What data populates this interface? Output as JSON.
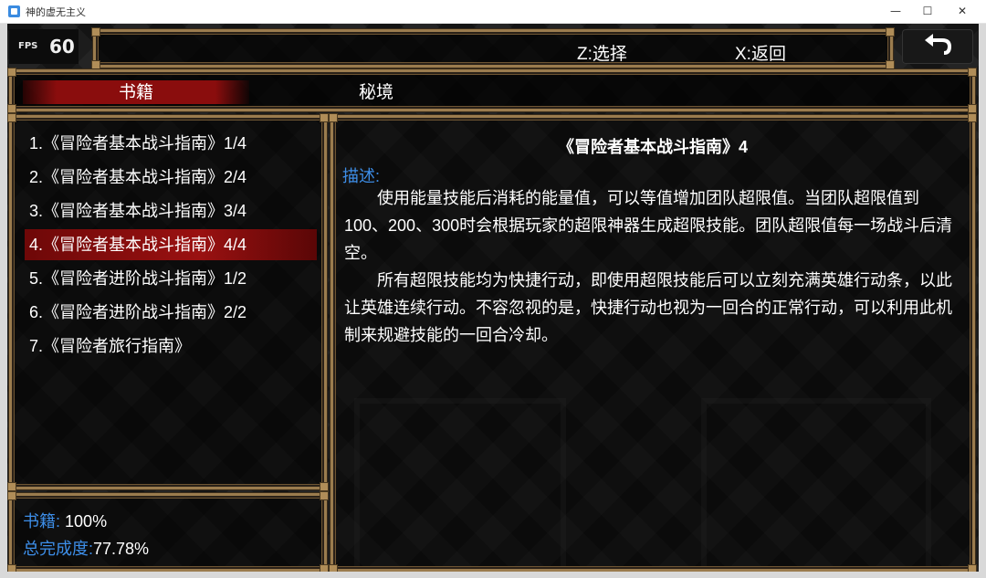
{
  "window": {
    "title": "神的虚无主义",
    "minimize": "—",
    "maximize": "☐",
    "close": "✕"
  },
  "fps": {
    "label": "FPS",
    "value": "60"
  },
  "hints": {
    "select": "Z:选择",
    "back": "X:返回"
  },
  "tabs": [
    {
      "label": "书籍",
      "active": true
    },
    {
      "label": "秘境",
      "active": false
    }
  ],
  "book_list": [
    {
      "label": "1.《冒险者基本战斗指南》1/4",
      "selected": false
    },
    {
      "label": "2.《冒险者基本战斗指南》2/4",
      "selected": false
    },
    {
      "label": "3.《冒险者基本战斗指南》3/4",
      "selected": false
    },
    {
      "label": "4.《冒险者基本战斗指南》4/4",
      "selected": true
    },
    {
      "label": "5.《冒险者进阶战斗指南》1/2",
      "selected": false
    },
    {
      "label": "6.《冒险者进阶战斗指南》2/2",
      "selected": false
    },
    {
      "label": "7.《冒险者旅行指南》",
      "selected": false
    }
  ],
  "stats": {
    "books_label": "书籍:",
    "books_value": "100%",
    "total_label": "总完成度:",
    "total_value": "77.78%"
  },
  "detail": {
    "title": "《冒险者基本战斗指南》4",
    "desc_label": "描述:",
    "paragraph1": "使用能量技能后消耗的能量值，可以等值增加团队超限值。当团队超限值到100、200、300时会根据玩家的超限神器生成超限技能。团队超限值每一场战斗后清空。",
    "paragraph2": "所有超限技能均为快捷行动，即使用超限技能后可以立刻充满英雄行动条，以此让英雄连续行动。不容忽视的是，快捷行动也视为一回合的正常行动，可以利用此机制来规避技能的一回合冷却。"
  },
  "colors": {
    "accent_blue": "#3d8ee8",
    "selection_red": "#9a1111",
    "frame_gold": "#9b7c4e"
  }
}
